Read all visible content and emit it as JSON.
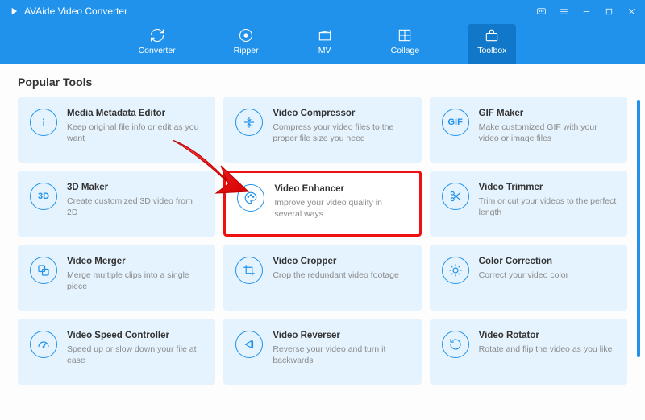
{
  "app": {
    "title": "AVAide Video Converter"
  },
  "nav": {
    "converter": "Converter",
    "ripper": "Ripper",
    "mv": "MV",
    "collage": "Collage",
    "toolbox": "Toolbox"
  },
  "section": {
    "title": "Popular Tools"
  },
  "tools": {
    "metadata": {
      "title": "Media Metadata Editor",
      "desc": "Keep original file info or edit as you want"
    },
    "compressor": {
      "title": "Video Compressor",
      "desc": "Compress your video files to the proper file size you need"
    },
    "gifmaker": {
      "title": "GIF Maker",
      "desc": "Make customized GIF with your video or image files",
      "icon_text": "GIF"
    },
    "maker3d": {
      "title": "3D Maker",
      "desc": "Create customized 3D video from 2D",
      "icon_text": "3D"
    },
    "enhancer": {
      "title": "Video Enhancer",
      "desc": "Improve your video quality in several ways"
    },
    "trimmer": {
      "title": "Video Trimmer",
      "desc": "Trim or cut your videos to the perfect length"
    },
    "merger": {
      "title": "Video Merger",
      "desc": "Merge multiple clips into a single piece"
    },
    "cropper": {
      "title": "Video Cropper",
      "desc": "Crop the redundant video footage"
    },
    "colorcorr": {
      "title": "Color Correction",
      "desc": "Correct your video color"
    },
    "speed": {
      "title": "Video Speed Controller",
      "desc": "Speed up or slow down your file at ease"
    },
    "reverser": {
      "title": "Video Reverser",
      "desc": "Reverse your video and turn it backwards"
    },
    "rotator": {
      "title": "Video Rotator",
      "desc": "Rotate and flip the video as you like"
    }
  }
}
